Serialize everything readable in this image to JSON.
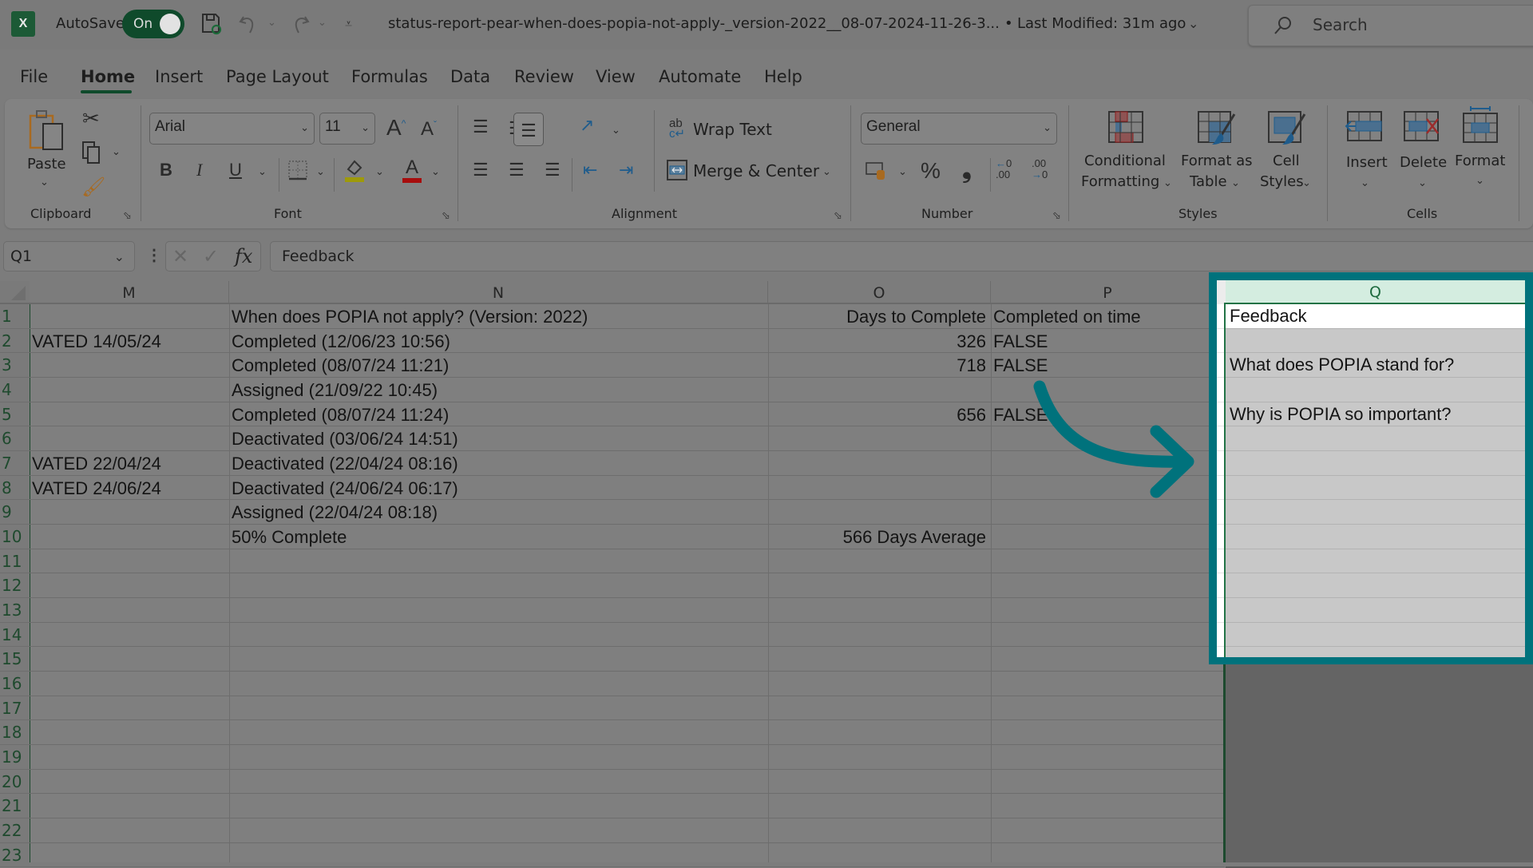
{
  "titlebar": {
    "app_icon": "excel-icon",
    "autosave_label": "AutoSave",
    "autosave_state": "On",
    "filename": "status-report-pear-when-does-popia-not-apply-_version-2022__08-07-2024-11-26-3...",
    "separator": "•",
    "last_modified": "Last Modified: 31m ago",
    "search_placeholder": "Search"
  },
  "tabs": [
    {
      "label": "File"
    },
    {
      "label": "Home",
      "active": true
    },
    {
      "label": "Insert"
    },
    {
      "label": "Page Layout"
    },
    {
      "label": "Formulas"
    },
    {
      "label": "Data"
    },
    {
      "label": "Review"
    },
    {
      "label": "View"
    },
    {
      "label": "Automate"
    },
    {
      "label": "Help"
    }
  ],
  "ribbon": {
    "clipboard": {
      "label": "Clipboard",
      "paste": "Paste"
    },
    "font": {
      "label": "Font",
      "font_name": "Arial",
      "font_size": "11",
      "bold": "B",
      "italic": "I",
      "underline": "U",
      "grow": "A",
      "shrink": "A",
      "font_color_letter": "A"
    },
    "alignment": {
      "label": "Alignment",
      "wrap_text": "Wrap Text",
      "merge_center": "Merge & Center"
    },
    "number": {
      "label": "Number",
      "format": "General",
      "percent": "%",
      "comma": "9",
      "inc_decimal": "←0\n.00",
      "dec_decimal": ".00\n→0"
    },
    "styles": {
      "label": "Styles",
      "conditional_1": "Conditional",
      "conditional_2": "Formatting",
      "format_table_1": "Format as",
      "format_table_2": "Table",
      "cell_styles_1": "Cell",
      "cell_styles_2": "Styles"
    },
    "cells": {
      "label": "Cells",
      "insert": "Insert",
      "delete": "Delete",
      "format": "Format"
    }
  },
  "formula_bar": {
    "name_box": "Q1",
    "fx": "fx",
    "value": "Feedback"
  },
  "sheet": {
    "columns": [
      "M",
      "N",
      "O",
      "P",
      "Q"
    ],
    "row_numbers": [
      "1",
      "2",
      "3",
      "4",
      "5",
      "6",
      "7",
      "8",
      "9",
      "10",
      "11",
      "12",
      "13",
      "14",
      "15",
      "16",
      "17",
      "18",
      "19",
      "20",
      "21",
      "22",
      "23"
    ],
    "rows": [
      {
        "M": "",
        "N": "When does POPIA not apply?  (Version: 2022)",
        "O": "Days to Complete",
        "P": "Completed on time",
        "Q": "Feedback"
      },
      {
        "M": "VATED 14/05/24",
        "N": "Completed (12/06/23 10:56)",
        "O": "326",
        "P": "FALSE",
        "Q": ""
      },
      {
        "M": "",
        "N": "Completed (08/07/24 11:21)",
        "O": "718",
        "P": "FALSE",
        "Q": "What does POPIA stand for?"
      },
      {
        "M": "",
        "N": "Assigned (21/09/22 10:45)",
        "O": "",
        "P": "",
        "Q": ""
      },
      {
        "M": "",
        "N": "Completed (08/07/24 11:24)",
        "O": "656",
        "P": "FALSE",
        "Q": "Why is POPIA so important?"
      },
      {
        "M": "",
        "N": "Deactivated (03/06/24 14:51)",
        "O": "",
        "P": "",
        "Q": ""
      },
      {
        "M": "VATED 22/04/24",
        "N": "Deactivated (22/04/24 08:16)",
        "O": "",
        "P": "",
        "Q": ""
      },
      {
        "M": "VATED 24/06/24",
        "N": "Deactivated (24/06/24 06:17)",
        "O": "",
        "P": "",
        "Q": ""
      },
      {
        "M": "",
        "N": "Assigned (22/04/24 08:18)",
        "O": "",
        "P": "",
        "Q": ""
      },
      {
        "M": "",
        "N": "50% Complete",
        "O": "566 Days Average",
        "P": "",
        "Q": ""
      }
    ],
    "selected_cell": "Q1"
  },
  "annotation": {
    "highlight_color": "#00727c",
    "arrow": "curved-arrow-pointing-to-column-Q"
  },
  "colors": {
    "excel_green": "#0f4a2b",
    "highlight_teal": "#00727c",
    "selected_header": "#d4ede0"
  }
}
